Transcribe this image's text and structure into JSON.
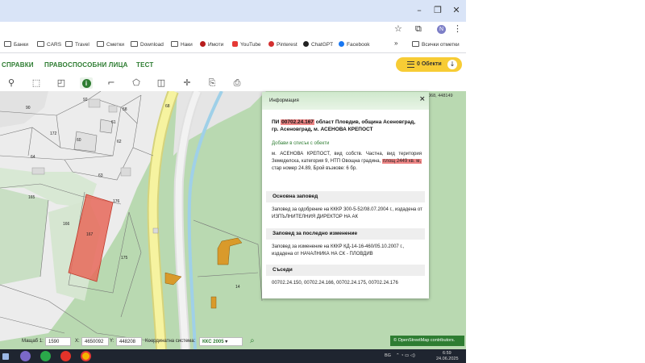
{
  "browser": {
    "window_controls": {
      "minimize": "–",
      "maximize": "❐",
      "close": "✕"
    },
    "profile_initial": "N",
    "bookmarks": [
      {
        "label": "Банки",
        "icon": "folder-icon"
      },
      {
        "label": "CARS",
        "icon": "folder-icon"
      },
      {
        "label": "Travel",
        "icon": "folder-icon"
      },
      {
        "label": "Сметки",
        "icon": "folder-icon"
      },
      {
        "label": "Download",
        "icon": "folder-icon"
      },
      {
        "label": "Наки",
        "icon": "folder-icon"
      },
      {
        "label": "Имоти",
        "icon": "circle-icon",
        "color": "#b71c1c"
      },
      {
        "label": "YouTube",
        "icon": "youtube-icon",
        "color": "#e53935"
      },
      {
        "label": "Pinterest",
        "icon": "pinterest-icon",
        "color": "#d32f2f"
      },
      {
        "label": "ChatGPT",
        "icon": "chatgpt-icon",
        "color": "#222222"
      },
      {
        "label": "Facebook",
        "icon": "facebook-icon",
        "color": "#1877f2"
      }
    ],
    "bookmarks_overflow": "»",
    "all_bookmarks": "Всички отметки"
  },
  "app": {
    "nav": [
      "СПРАВКИ",
      "ПРАВОСПОСОБНИ ЛИЦА",
      "ТЕСТ"
    ],
    "objects_button": "0 Обекти",
    "accent_color": "#2e7d32",
    "objects_color": "#f7cc35"
  },
  "map": {
    "coords_fragment": "068, 448149",
    "parcel_labels": [
      "92",
      "61",
      "68",
      "90",
      "58",
      "172",
      "60",
      "62",
      "64",
      "63",
      "165",
      "176",
      "166",
      "167",
      "175",
      "14"
    ],
    "selected_parcel_color": "#e8685a"
  },
  "info": {
    "header": "Информация",
    "close": "×",
    "title_prefix": "ПИ",
    "title_id": "00702.24.167",
    "title_rest": "област Пловдив, община Асеновград, гр. Асеновград, м. АСЕНОВА КРЕПОСТ",
    "add_link": "Добави в списък с обекти",
    "desc_part1": "м. АСЕНОВА КРЕПОСТ, вид собств. Частна, вид територия Земеделска, категория 9, НТП Овощна градина,",
    "desc_area": "площ 2449 кв. м,",
    "desc_part2": "стар номер 24.89, Брой възкове: 6 бр.",
    "order_title": "Основна заповед",
    "order_text": "Заповед за одобрение на КККР 300-5-52/08.07.2004 г., издадена от ИЗПЪЛНИТЕЛНИЯ ДИРЕКТОР НА АК",
    "last_change_title": "Заповед за последно изменение",
    "last_change_text": "Заповед за изменение на КККР КД-14-16-460/05.10.2007 г., издадена от НАЧАЛНИКА НА СК - ПЛОВДИВ",
    "neighbors_title": "Съседи",
    "neighbors_text": "00702.24.150, 00702.24.166, 00702.24.175, 00702.24.176"
  },
  "bottom": {
    "scale_label": "Мащаб 1:",
    "scale_value": "1590",
    "x_label": "X:",
    "x_value": "4650092",
    "y_label": "Y:",
    "y_value": "448208",
    "coord_system_label": "Координатна система:",
    "coord_system_value": "ККС 2005",
    "osm_credit": "© OpenStreetMap contributors."
  },
  "taskbar": {
    "lang": "BG",
    "time": "6:59",
    "date": "24.06.2025"
  }
}
